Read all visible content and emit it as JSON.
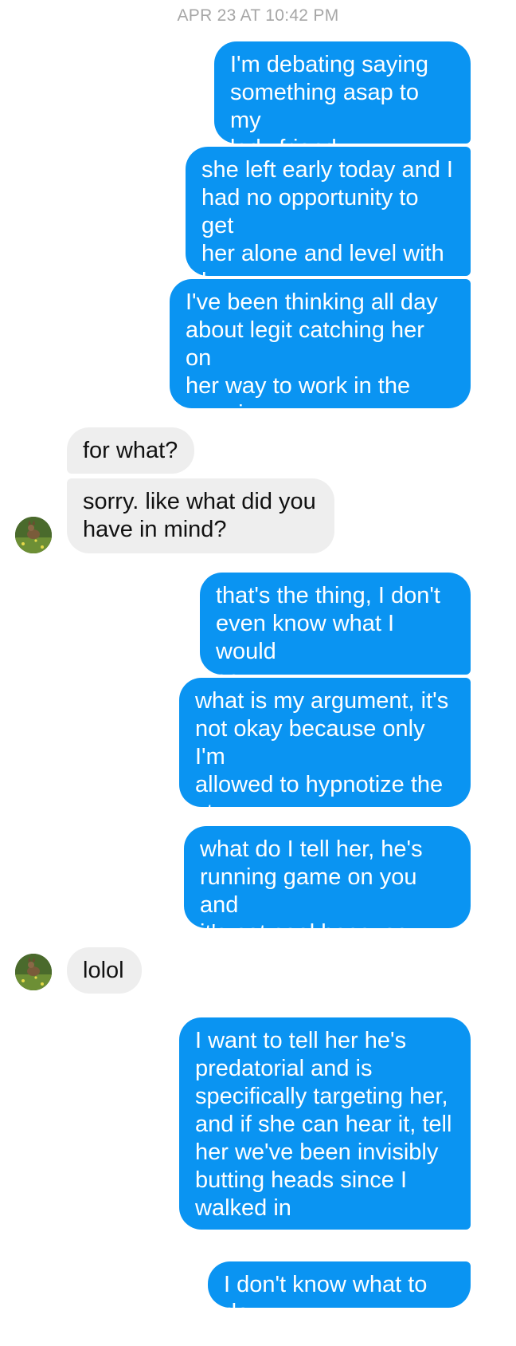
{
  "thread": {
    "timestamp": "APR 23 AT 10:42 PM",
    "messages": [
      {
        "sender": "me",
        "text": "I'm debating saying\nsomething asap to my\nlady friend"
      },
      {
        "sender": "me",
        "text": "she left early today and I\nhad no opportunity to get\nher alone and level with\nher"
      },
      {
        "sender": "me",
        "text": "I've been thinking all day\nabout legit catching her on\nher way to work in the\nmorning"
      },
      {
        "sender": "them",
        "text": "for what?"
      },
      {
        "sender": "them",
        "text": "sorry. like what did you\nhave in mind?"
      },
      {
        "sender": "me",
        "text": "that's the thing, I don't\neven know what I would\nsay"
      },
      {
        "sender": "me",
        "text": "what is my argument, it's\nnot okay because only I'm\nallowed to hypnotize the\nstore"
      },
      {
        "sender": "me",
        "text": "what do I tell her, he's\nrunning game on you and\nit's not cool because....."
      },
      {
        "sender": "them",
        "text": "lolol"
      },
      {
        "sender": "me",
        "text": "I want to tell her he's\npredatorial and is\nspecifically targeting her,\nand if she can hear it, tell\nher we've been invisibly\nbutting heads since I\nwalked in"
      },
      {
        "sender": "me",
        "text": "I don't know what to do"
      }
    ]
  },
  "colors": {
    "outgoing_bubble": "#0a94f2",
    "incoming_bubble": "#eeeeee",
    "timestamp_text": "#a6a6a6"
  },
  "icons": {
    "contact_avatar": "deer-in-grass-photo"
  }
}
